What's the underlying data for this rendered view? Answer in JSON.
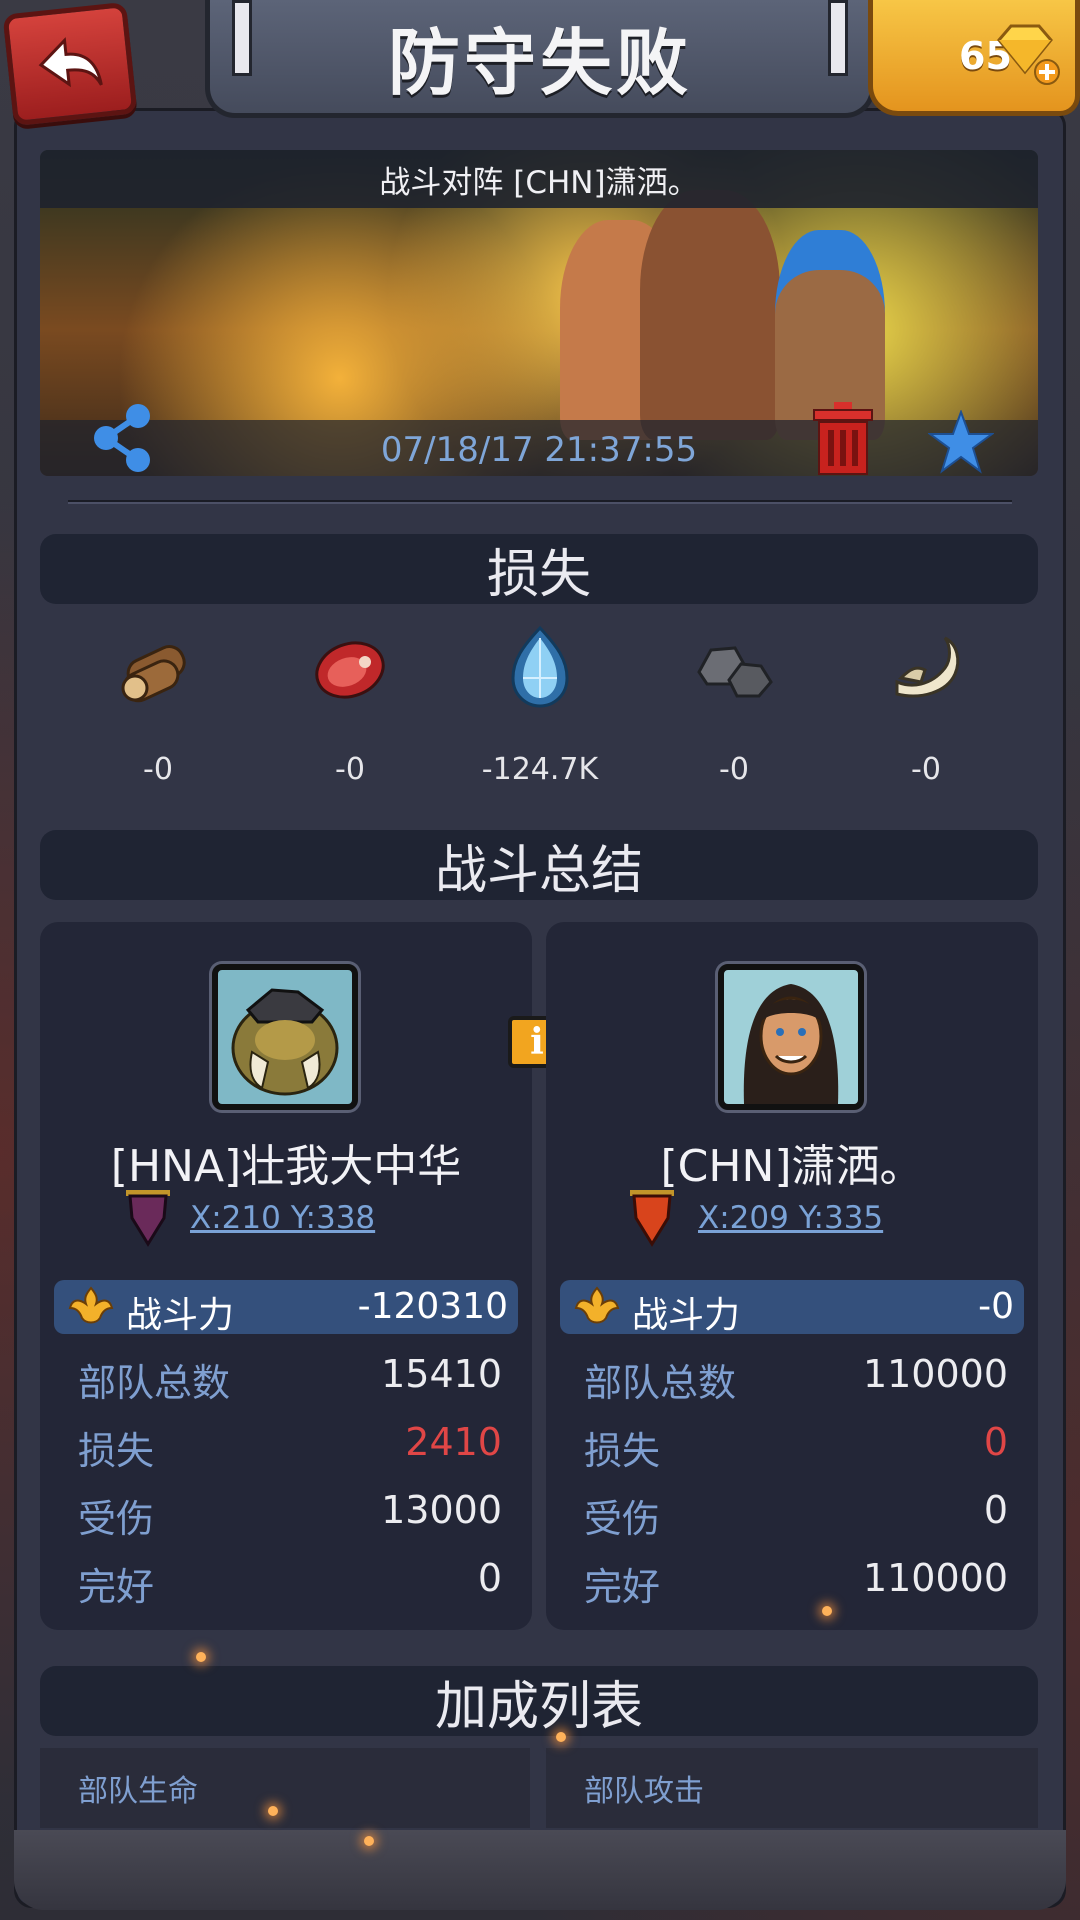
{
  "header": {
    "title": "防守失败",
    "gems": "65"
  },
  "banner": {
    "title": "战斗对阵 [CHN]潇洒。",
    "timestamp": "07/18/17 21:37:55"
  },
  "losses": {
    "title": "损失",
    "items": [
      {
        "icon": "wood-icon",
        "value": "-0"
      },
      {
        "icon": "meat-icon",
        "value": "-0"
      },
      {
        "icon": "crystal-icon",
        "value": "-124.7K"
      },
      {
        "icon": "stone-icon",
        "value": "-0"
      },
      {
        "icon": "bone-icon",
        "value": "-0"
      }
    ]
  },
  "summary": {
    "title": "战斗总结",
    "left": {
      "name": "[HNA]壮我大中华",
      "coords": "X:210 Y:338",
      "power_label": "战斗力",
      "power": "-120310",
      "stats": [
        {
          "label": "部队总数",
          "value": "15410"
        },
        {
          "label": "损失",
          "value": "2410"
        },
        {
          "label": "受伤",
          "value": "13000"
        },
        {
          "label": "完好",
          "value": "0"
        }
      ]
    },
    "right": {
      "name": "[CHN]潇洒。",
      "coords": "X:209 Y:335",
      "power_label": "战斗力",
      "power": "-0",
      "stats": [
        {
          "label": "部队总数",
          "value": "110000"
        },
        {
          "label": "损失",
          "value": "0"
        },
        {
          "label": "受伤",
          "value": "0"
        },
        {
          "label": "完好",
          "value": "110000"
        }
      ]
    },
    "info_glyph": "i"
  },
  "bonus": {
    "title": "加成列表",
    "left_label": "部队生命",
    "right_label": "部队攻击"
  },
  "colors": {
    "accent_gold": "#f2a51f",
    "loss_red": "#e04646",
    "link_blue": "#7aa2d6",
    "power_bar": "#34507c"
  }
}
